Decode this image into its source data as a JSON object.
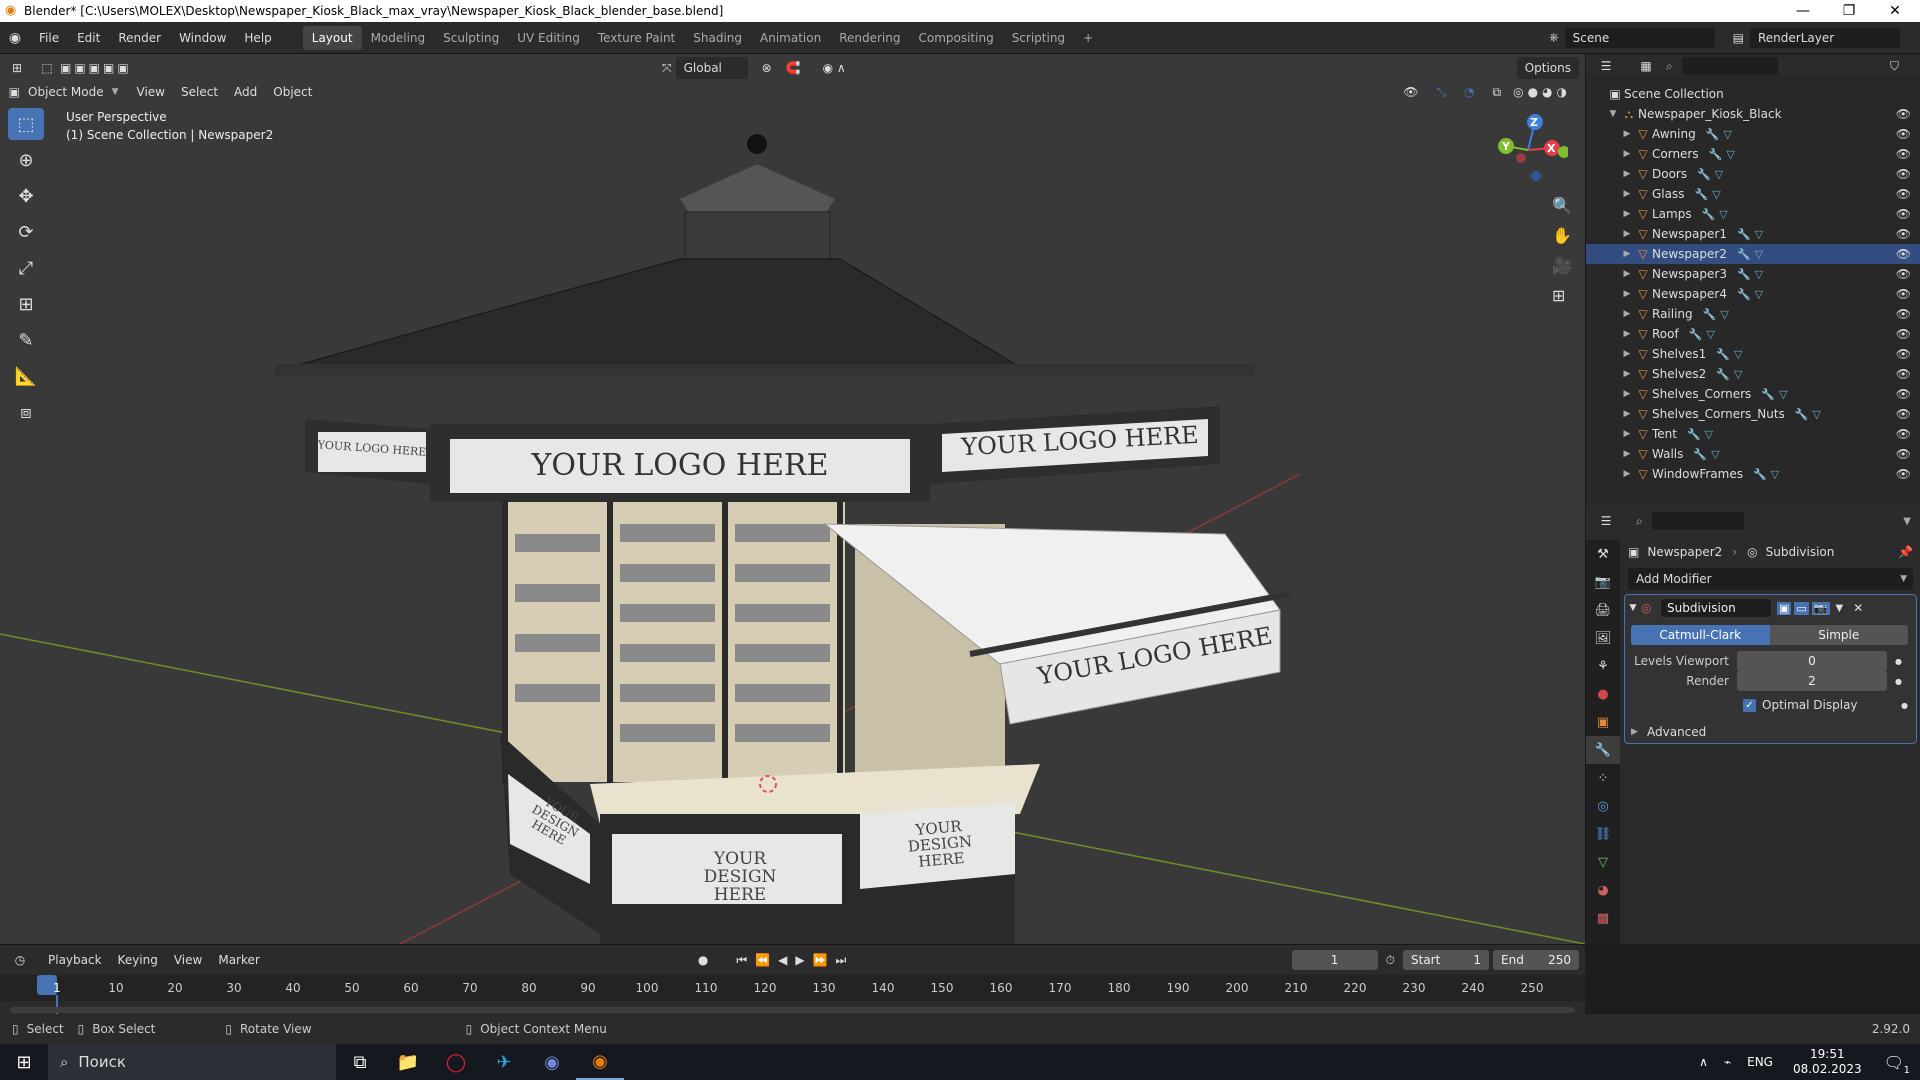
{
  "window": {
    "title": "Blender* [C:\\Users\\MOLEX\\Desktop\\Newspaper_Kiosk_Black_max_vray\\Newspaper_Kiosk_Black_blender_base.blend]",
    "minimize": "—",
    "maximize": "❐",
    "close": "✕"
  },
  "menus": [
    "File",
    "Edit",
    "Render",
    "Window",
    "Help"
  ],
  "workspaces": [
    "Layout",
    "Modeling",
    "Sculpting",
    "UV Editing",
    "Texture Paint",
    "Shading",
    "Animation",
    "Rendering",
    "Compositing",
    "Scripting"
  ],
  "active_workspace": "Layout",
  "add_workspace": "+",
  "scene": "Scene",
  "render_layer": "RenderLayer",
  "viewport_header": {
    "transform_orientation": "Global",
    "options": "Options",
    "mode": "Object Mode",
    "menus": [
      "View",
      "Select",
      "Add",
      "Object"
    ]
  },
  "viewport_overlay": {
    "line1": "User Perspective",
    "line2": "(1) Scene Collection | Newspaper2"
  },
  "gizmo": {
    "x": "X",
    "y": "Y",
    "z": "Z"
  },
  "kiosk_text": {
    "logo": "YOUR LOGO HERE",
    "design": "YOUR DESIGN HERE"
  },
  "outliner": {
    "root": "Scene Collection",
    "collection": "Newspaper_Kiosk_Black",
    "items": [
      "Awning",
      "Corners",
      "Doors",
      "Glass",
      "Lamps",
      "Newspaper1",
      "Newspaper2",
      "Newspaper3",
      "Newspaper4",
      "Railing",
      "Roof",
      "Shelves1",
      "Shelves2",
      "Shelves_Corners",
      "Shelves_Corners_Nuts",
      "Tent",
      "Walls",
      "WindowFrames"
    ],
    "selected": "Newspaper2"
  },
  "properties": {
    "object": "Newspaper2",
    "modifier_context": "Subdivision",
    "add_modifier": "Add Modifier",
    "modifier_name": "Subdivision",
    "type_options": [
      "Catmull-Clark",
      "Simple"
    ],
    "type_selected": "Catmull-Clark",
    "levels_viewport_label": "Levels Viewport",
    "levels_viewport": "0",
    "render_label": "Render",
    "render": "2",
    "optimal_display_label": "Optimal Display",
    "optimal_display": true,
    "advanced": "Advanced"
  },
  "timeline": {
    "menus": [
      "Playback",
      "Keying",
      "View",
      "Marker"
    ],
    "current_frame": "1",
    "start_label": "Start",
    "start": "1",
    "end_label": "End",
    "end": "250",
    "ticks": [
      "1",
      "10",
      "20",
      "30",
      "40",
      "50",
      "60",
      "70",
      "80",
      "90",
      "100",
      "110",
      "120",
      "130",
      "140",
      "150",
      "160",
      "170",
      "180",
      "190",
      "200",
      "210",
      "220",
      "230",
      "240",
      "250"
    ]
  },
  "statusbar": {
    "select": "Select",
    "box_select": "Box Select",
    "rotate_view": "Rotate View",
    "context_menu": "Object Context Menu",
    "version": "2.92.0"
  },
  "taskbar": {
    "search": "Поиск",
    "lang": "ENG",
    "time": "19:51",
    "date": "08.02.2023",
    "notif_count": "1"
  },
  "colors": {
    "accent": "#4772b3",
    "selection": "#334d80",
    "viewport_bg": "#393939",
    "axis_x": "#e0414f",
    "axis_y": "#7fbf2f",
    "axis_z": "#3e7fe0"
  }
}
